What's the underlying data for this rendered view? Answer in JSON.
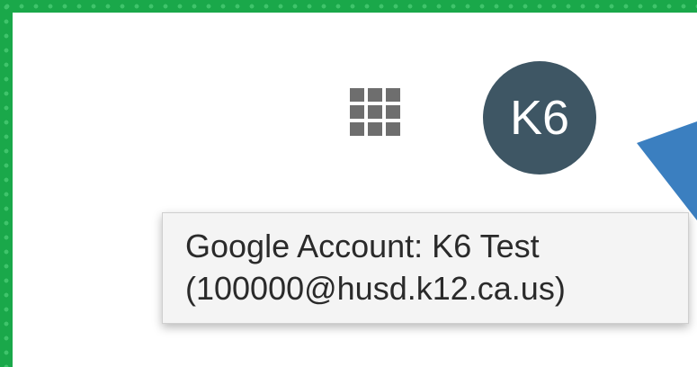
{
  "frame": {
    "border_color": "#1aa84a",
    "dot_color": "#3fc46b"
  },
  "header": {
    "apps_icon": "apps-grid-icon",
    "avatar": {
      "initials": "K6",
      "background_color": "#3e5664"
    }
  },
  "annotation": {
    "arrow_color": "#3b7fc0"
  },
  "tooltip": {
    "line1": "Google Account: K6 Test",
    "line2": "(100000@husd.k12.ca.us)"
  }
}
